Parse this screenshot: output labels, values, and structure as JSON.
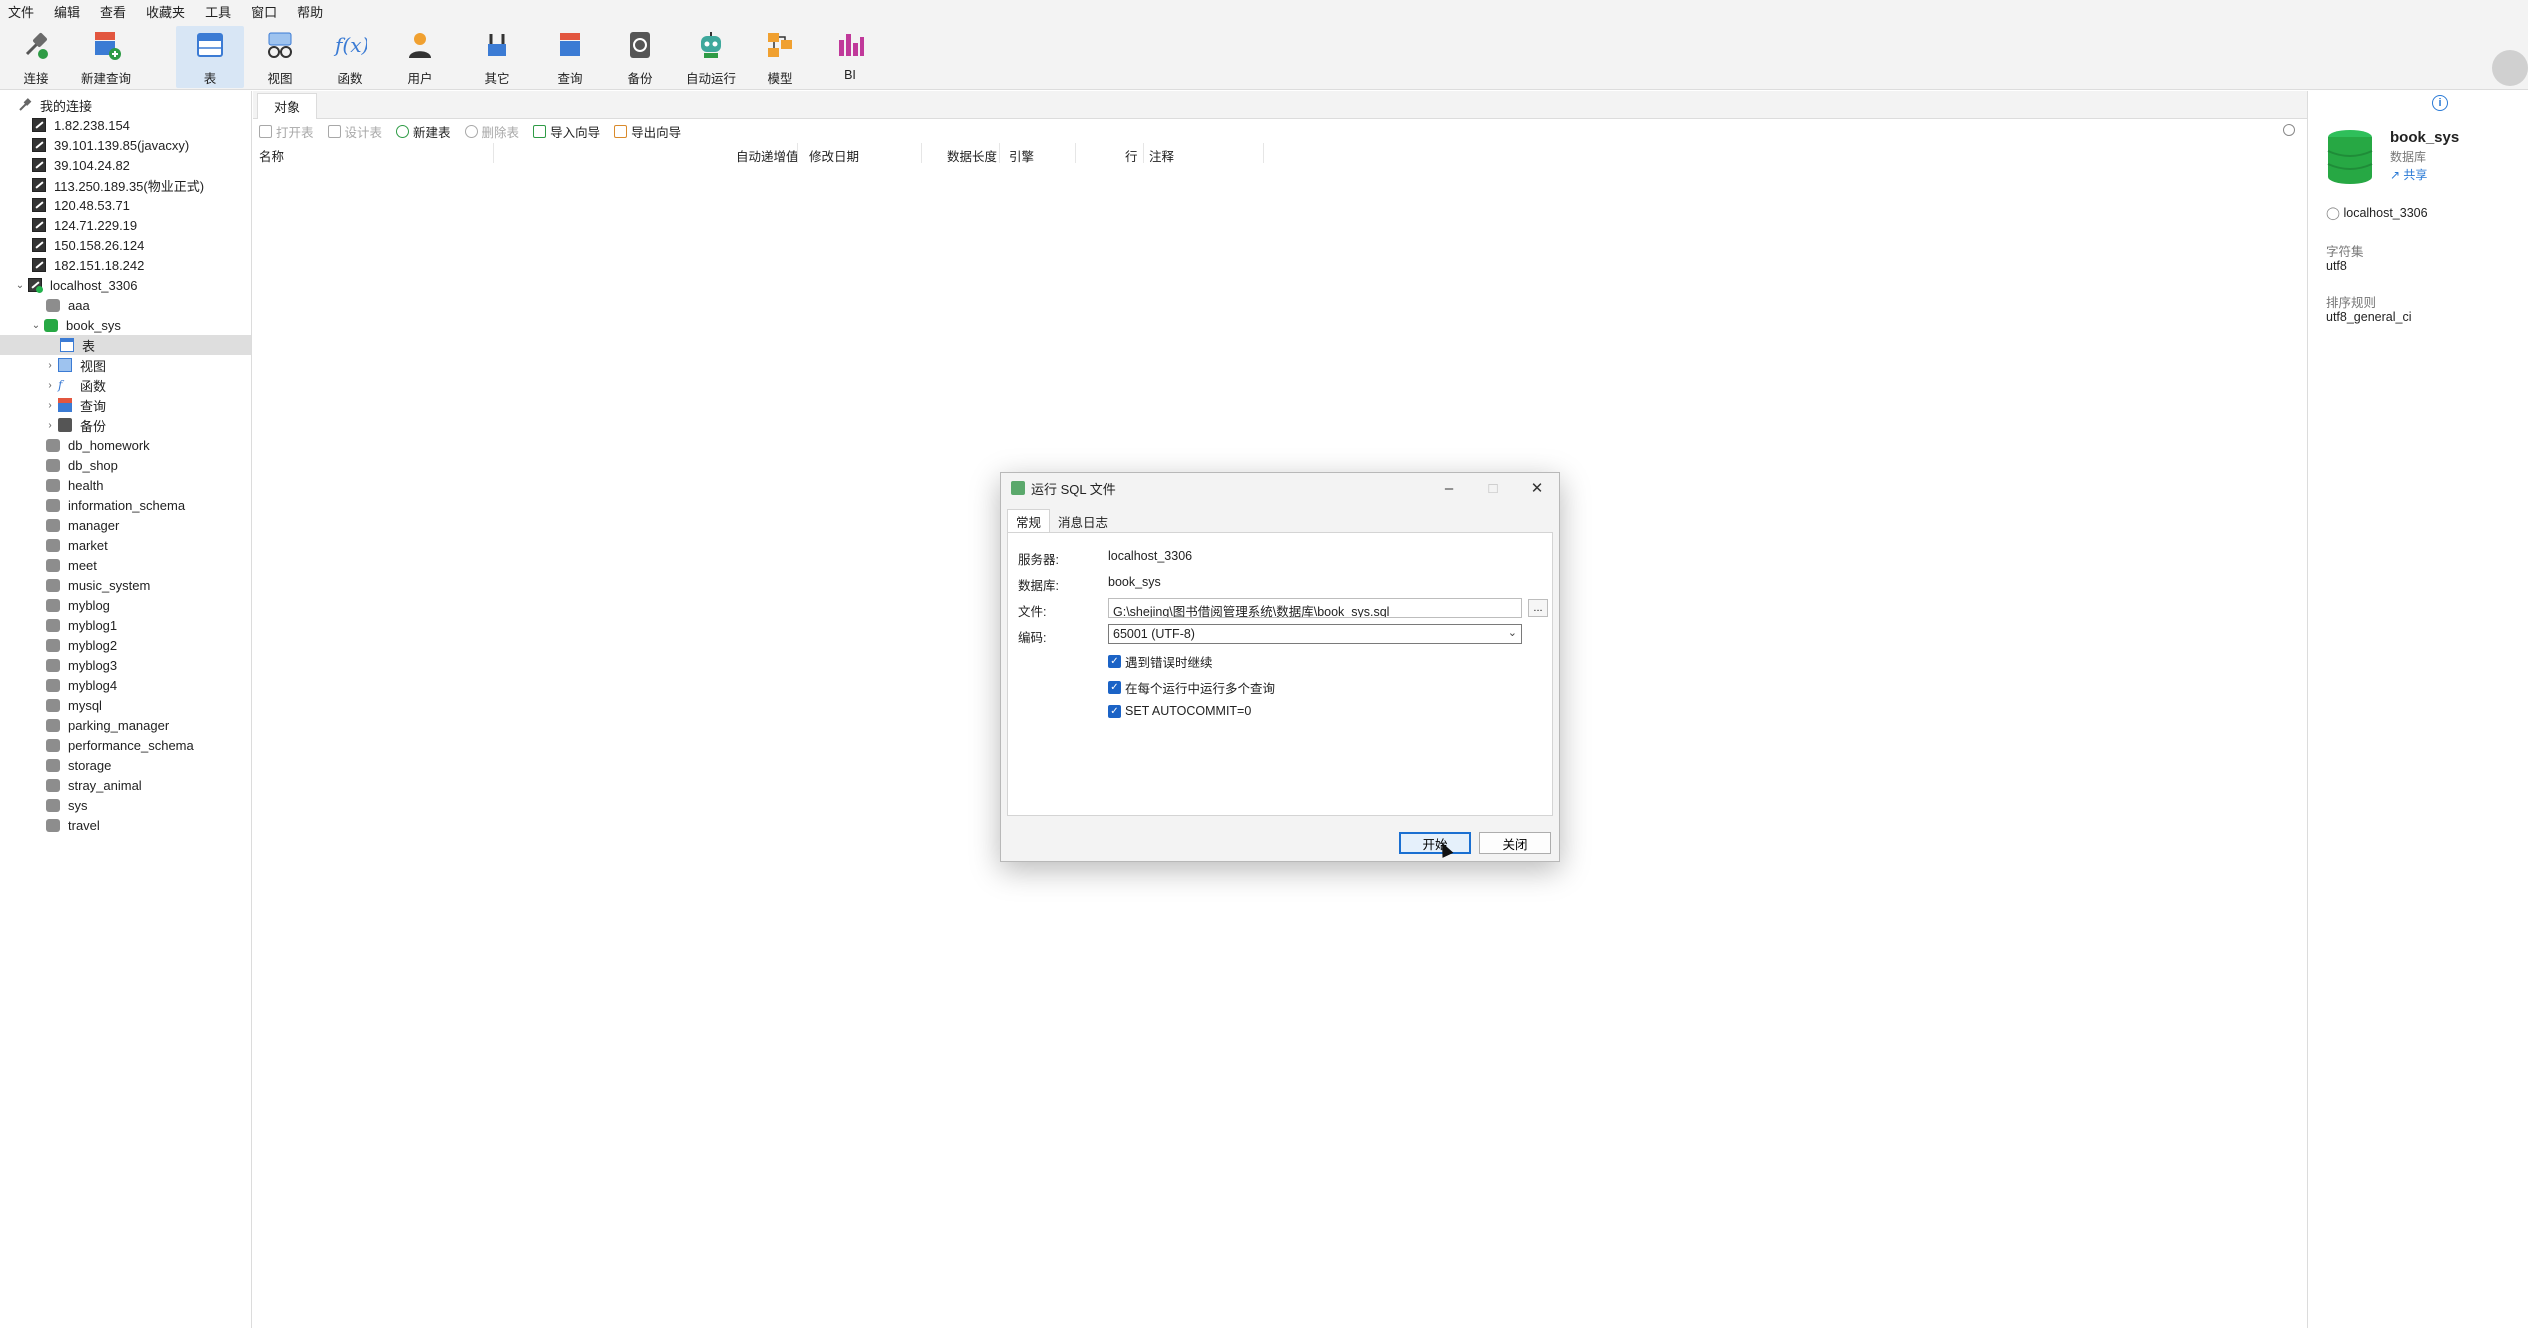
{
  "menu": [
    "文件",
    "编辑",
    "查看",
    "收藏夹",
    "工具",
    "窗口",
    "帮助"
  ],
  "toolbar": {
    "buttons": [
      {
        "id": "connect",
        "label": "连接"
      },
      {
        "id": "new-query",
        "label": "新建查询"
      },
      {
        "id": "table",
        "label": "表"
      },
      {
        "id": "view",
        "label": "视图"
      },
      {
        "id": "function",
        "label": "函数"
      },
      {
        "id": "user",
        "label": "用户"
      },
      {
        "id": "other",
        "label": "其它"
      },
      {
        "id": "query",
        "label": "查询"
      },
      {
        "id": "backup",
        "label": "备份"
      },
      {
        "id": "automation",
        "label": "自动运行"
      },
      {
        "id": "model",
        "label": "模型"
      },
      {
        "id": "bi",
        "label": "BI"
      }
    ],
    "active": "table"
  },
  "tree": {
    "root_label": "我的连接",
    "connections": [
      "1.82.238.154",
      "39.101.139.85(javacxy)",
      "39.104.24.82",
      "113.250.189.35(物业正式)",
      "120.48.53.71",
      "124.71.229.19",
      "150.158.26.124",
      "182.151.18.242"
    ],
    "open_connection": "localhost_3306",
    "databases": [
      "aaa",
      "book_sys"
    ],
    "open_database": "book_sys",
    "db_children": [
      "表",
      "视图",
      "函数",
      "查询",
      "备份"
    ],
    "selected_child": "表",
    "more_databases": [
      "db_homework",
      "db_shop",
      "health",
      "information_schema",
      "manager",
      "market",
      "meet",
      "music_system",
      "myblog",
      "myblog1",
      "myblog2",
      "myblog3",
      "myblog4",
      "mysql",
      "parking_manager",
      "performance_schema",
      "storage",
      "stray_animal",
      "sys",
      "travel"
    ]
  },
  "main": {
    "tab_label": "对象",
    "obj_toolbar": {
      "open_table": "打开表",
      "design_table": "设计表",
      "new_table": "新建表",
      "delete_table": "删除表",
      "import_wizard": "导入向导",
      "export_wizard": "导出向导"
    },
    "columns": {
      "name": "名称",
      "auto_increment": "自动递增值",
      "modified": "修改日期",
      "data_length": "数据长度",
      "engine": "引擎",
      "rows": "行",
      "comment": "注释"
    }
  },
  "info_panel": {
    "title": "book_sys",
    "subtitle": "数据库",
    "share": "共享",
    "connection": "localhost_3306",
    "charset_label": "字符集",
    "charset_value": "utf8",
    "collation_label": "排序规则",
    "collation_value": "utf8_general_ci"
  },
  "dialog": {
    "title": "运行 SQL 文件",
    "tabs": [
      "常规",
      "消息日志"
    ],
    "server_label": "服务器:",
    "server_value": "localhost_3306",
    "database_label": "数据库:",
    "database_value": "book_sys",
    "file_label": "文件:",
    "file_value": "G:\\shejing\\图书借阅管理系统\\数据库\\book_sys.sql",
    "browse_label": "...",
    "encoding_label": "编码:",
    "encoding_value": "65001 (UTF-8)",
    "options": [
      "遇到错误时继续",
      "在每个运行中运行多个查询",
      "SET AUTOCOMMIT=0"
    ],
    "start_button": "开始",
    "close_button": "关闭"
  },
  "colors": {
    "accent": "#1a6fd1",
    "db_active": "#27a844",
    "db_inactive": "#8d8d8d",
    "toolbar_bg": "#f3f3f3"
  }
}
